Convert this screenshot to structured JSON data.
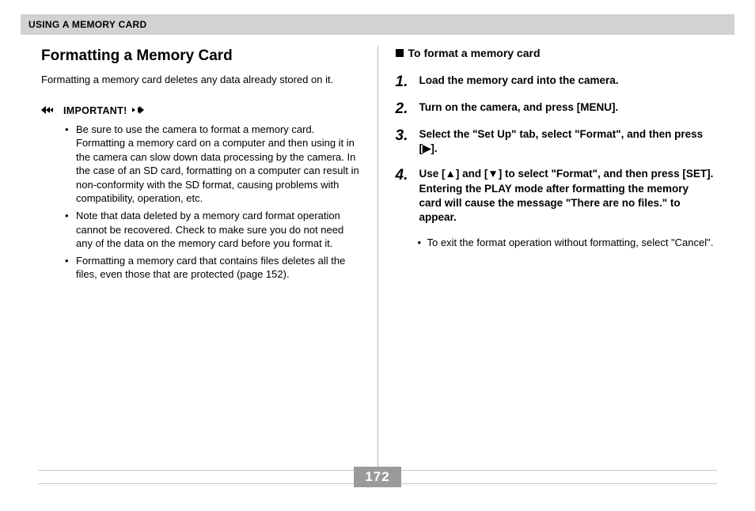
{
  "header": {
    "title": "USING A MEMORY CARD"
  },
  "left": {
    "section_title": "Formatting a Memory Card",
    "intro": "Formatting a memory card deletes any data already stored on it.",
    "important_label": "IMPORTANT!",
    "bullets": [
      "Be sure to use the camera to format a memory card. Formatting a memory card on a computer and then using it in the camera can slow down data processing by the camera. In the case of an SD card, formatting on a computer can result in non-conformity with the SD format, causing problems with compatibility, operation, etc.",
      "Note that data deleted by a memory card format operation cannot be recovered. Check to make sure you do not need any of the data on the memory card before you format it.",
      "Formatting a memory card that contains files deletes all the files, even those that are protected (page 152)."
    ]
  },
  "right": {
    "sub_heading": "To format a memory card",
    "steps": [
      {
        "n": "1.",
        "text": "Load the memory card into the camera."
      },
      {
        "n": "2.",
        "text": "Turn on the camera, and press [MENU]."
      },
      {
        "n": "3.",
        "text": "Select the \"Set Up\" tab, select \"Format\", and then press [▶]."
      },
      {
        "n": "4.",
        "text": "Use [▲] and [▼] to select \"Format\", and then press [SET]. Entering the PLAY mode after formatting the memory card will cause the message \"There are no files.\" to appear."
      }
    ],
    "sub_bullet": "To exit the format operation without formatting, select \"Cancel\"."
  },
  "page_number": "172"
}
